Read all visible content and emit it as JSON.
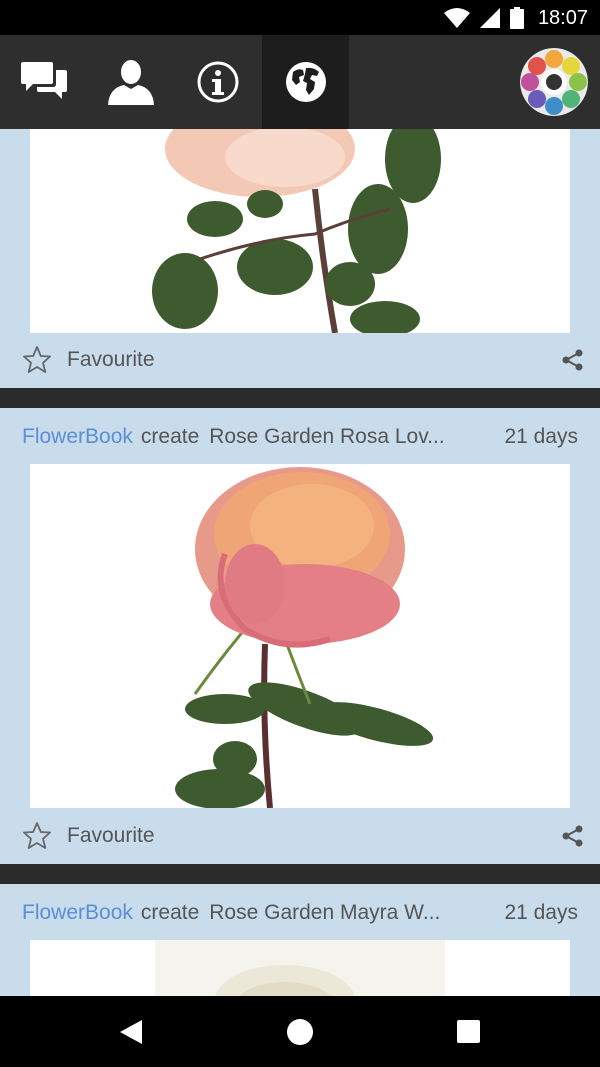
{
  "status_bar": {
    "time": "18:07"
  },
  "app_bar": {
    "tabs": [
      {
        "icon": "chat-icon"
      },
      {
        "icon": "profile-icon"
      },
      {
        "icon": "info-icon"
      },
      {
        "icon": "globe-icon",
        "active": true
      }
    ],
    "logo": "flower-logo"
  },
  "feed": {
    "cards": [
      {
        "favourite_label": "Favourite"
      },
      {
        "author": "FlowerBook",
        "verb": "create",
        "title": "Rose Garden Rosa Lov...",
        "time": "21 days",
        "favourite_label": "Favourite"
      },
      {
        "author": "FlowerBook",
        "verb": "create",
        "title": "Rose Garden Mayra W...",
        "time": "21 days"
      }
    ]
  },
  "colors": {
    "card_bg": "#c9dcec",
    "author_link": "#5a8fd8",
    "app_bar": "#2e2e2e"
  }
}
